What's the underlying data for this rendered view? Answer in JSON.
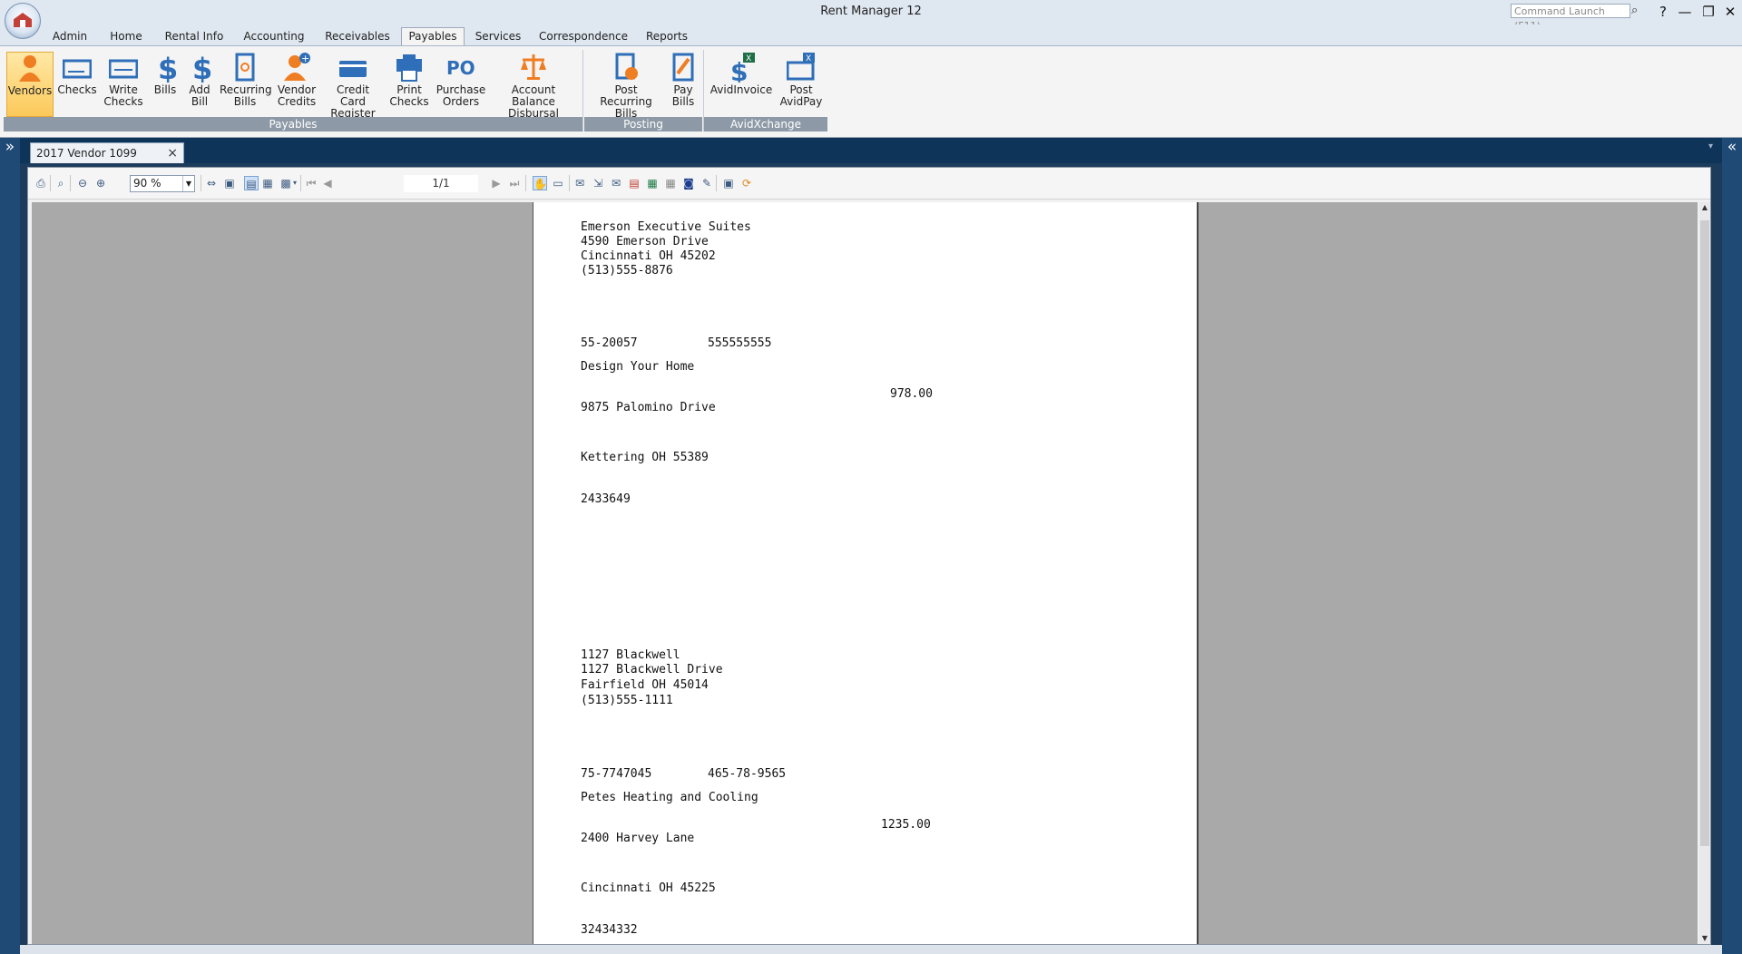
{
  "app": {
    "title": "Rent Manager 12",
    "command_launch_placeholder": "Command Launch (F11)"
  },
  "window_controls": {
    "help": "?",
    "minimize": "—",
    "restore": "❐",
    "close": "✕"
  },
  "ribbon_tabs": [
    "Admin",
    "Home",
    "Rental Info",
    "Accounting",
    "Receivables",
    "Payables",
    "Services",
    "Correspondence",
    "Reports"
  ],
  "active_tab": "Payables",
  "ribbon": {
    "payables_group": "Payables",
    "posting_group": "Posting",
    "avid_group": "AvidXchange",
    "buttons": {
      "vendors": "Vendors",
      "checks": "Checks",
      "write_checks": "Write Checks",
      "bills": "Bills",
      "add_bill": "Add Bill",
      "recurring_bills": "Recurring Bills",
      "vendor_credits": "Vendor Credits",
      "credit_card_register": "Credit Card Register",
      "print_checks": "Print Checks",
      "purchase_orders": "Purchase Orders",
      "account_balance_disbursal": "Account Balance Disbursal",
      "post_recurring_bills": "Post Recurring Bills",
      "pay_bills": "Pay Bills",
      "avidinvoice": "AvidInvoice",
      "post_avidpay": "Post AvidPay"
    }
  },
  "document_tab": {
    "label": "2017 Vendor 1099 (Report)"
  },
  "report_toolbar": {
    "zoom": "90 %",
    "page": "1/1"
  },
  "report": {
    "payer": {
      "name": "Emerson Executive Suites",
      "address": "4590 Emerson Drive",
      "city": "Cincinnati OH 45202",
      "phone": "(513)555-8876"
    },
    "forms": [
      {
        "payer_tin": "55-20057",
        "recipient_tin": "555555555",
        "recipient_name": "Design Your Home",
        "amount": "978.00",
        "street": "9875 Palomino Drive",
        "city": "Kettering OH 55389",
        "account": "2433649"
      },
      {
        "payer_name": "1127 Blackwell",
        "payer_address": "1127 Blackwell Drive",
        "payer_city": "Fairfield OH 45014",
        "payer_phone": "(513)555-1111",
        "payer_tin": "75-7747045",
        "recipient_tin": "465-78-9565",
        "recipient_name": "Petes Heating and Cooling",
        "amount": "1235.00",
        "street": "2400 Harvey Lane",
        "city": "Cincinnati OH 45225",
        "account": "32434332"
      }
    ]
  },
  "colors": {
    "ribbon_active": "#fcc95a",
    "brand_blue": "#2f6eb8",
    "accent_orange": "#ef7d22"
  }
}
